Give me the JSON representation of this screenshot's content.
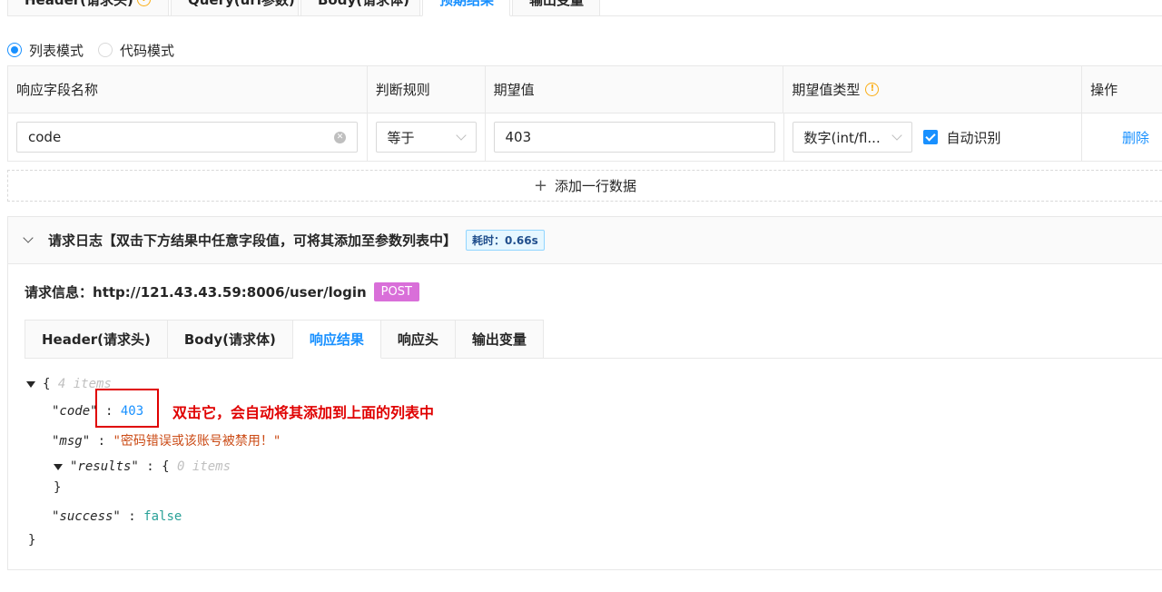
{
  "top_tabs": [
    {
      "label": "Header(请求头)",
      "warn": "!"
    },
    {
      "label": "Query(url参数)"
    },
    {
      "label": "Body(请求体)"
    },
    {
      "label": "预期结果",
      "active": true
    },
    {
      "label": "输出变量"
    }
  ],
  "modes": {
    "list_label": "列表模式",
    "code_label": "代码模式"
  },
  "table": {
    "headers": [
      "响应字段名称",
      "判断规则",
      "期望值",
      "期望值类型",
      "操作"
    ],
    "row": {
      "field": "code",
      "rule": "等于",
      "expected": "403",
      "type": "数字(int/fl...",
      "auto_detect_label": "自动识别",
      "delete_label": "删除"
    }
  },
  "add_row_label": "添加一行数据",
  "log": {
    "title": "请求日志【双击下方结果中任意字段值，可将其添加至参数列表中】",
    "time": "耗时：0.66s",
    "req_info_label": "请求信息：",
    "url": "http://121.43.43.59:8006/user/login",
    "method": "POST",
    "tabs": [
      "Header(请求头)",
      "Body(请求体)",
      "响应结果",
      "响应头",
      "输出变量"
    ],
    "active_tab": 2
  },
  "json_view": {
    "root_count": "4 items",
    "code_key": "\"code\"",
    "code_value": "403",
    "msg_key": "\"msg\"",
    "msg_value": "\"密码错误或该账号被禁用！\"",
    "results_key": "\"results\"",
    "results_count": "0 items",
    "success_key": "\"success\"",
    "success_value": "false"
  },
  "annotation": "双击它，会自动将其添加到上面的列表中",
  "colors": {
    "accent": "#1890ff",
    "annotation": "#e00000",
    "method_tag": "#d96fd9"
  }
}
